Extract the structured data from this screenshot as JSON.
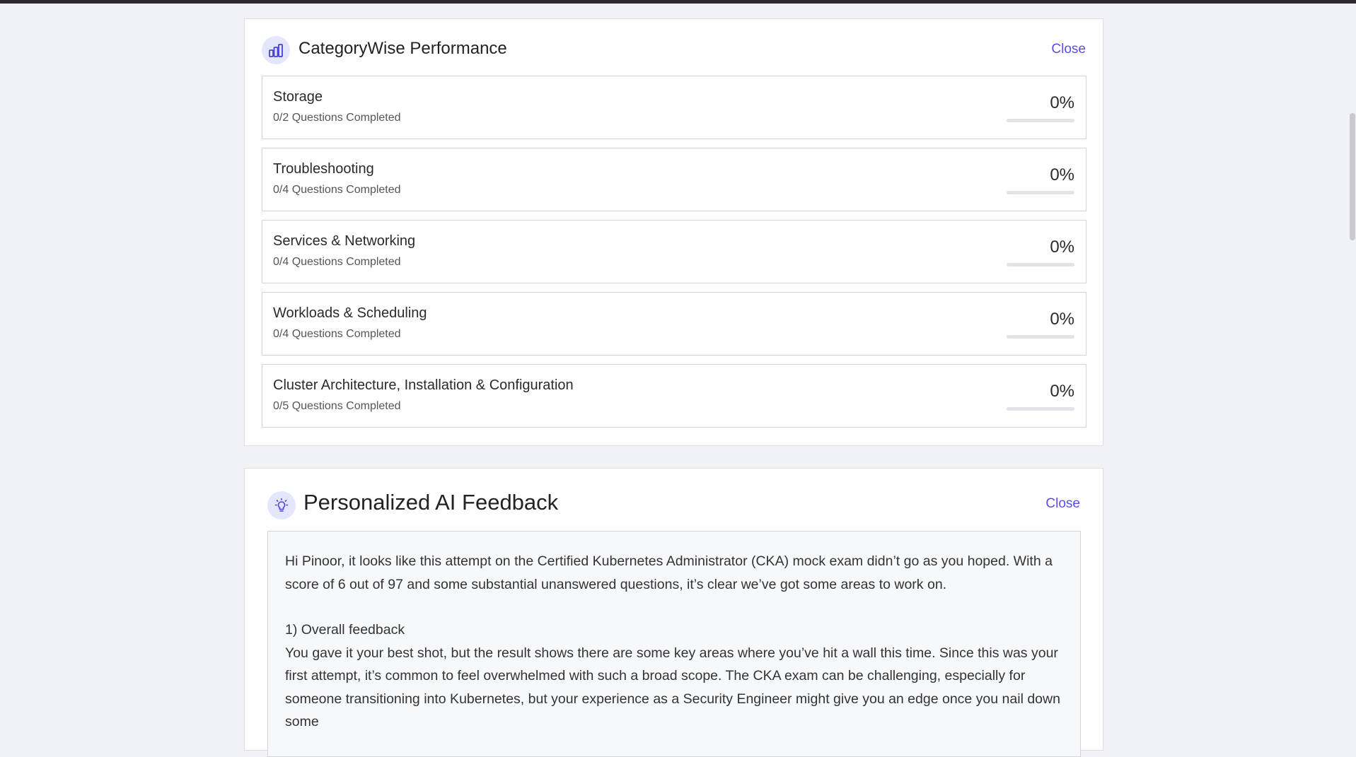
{
  "colors": {
    "accent": "#5a4ee6",
    "icon_bg": "#e4e6fb",
    "background": "#f1f2f5"
  },
  "performance": {
    "icon": "bar-chart-icon",
    "title": "CategoryWise Performance",
    "close_label": "Close",
    "categories": [
      {
        "name": "Storage",
        "completed": "0/2 Questions Completed",
        "percent_label": "0%",
        "progress": 0
      },
      {
        "name": "Troubleshooting",
        "completed": "0/4 Questions Completed",
        "percent_label": "0%",
        "progress": 0
      },
      {
        "name": "Services & Networking",
        "completed": "0/4 Questions Completed",
        "percent_label": "0%",
        "progress": 0
      },
      {
        "name": "Workloads & Scheduling",
        "completed": "0/4 Questions Completed",
        "percent_label": "0%",
        "progress": 0
      },
      {
        "name": "Cluster Architecture, Installation & Configuration",
        "completed": "0/5 Questions Completed",
        "percent_label": "0%",
        "progress": 0
      }
    ]
  },
  "feedback": {
    "icon": "lightbulb-icon",
    "title": "Personalized AI Feedback",
    "close_label": "Close",
    "paragraph_1": "Hi Pinoor, it looks like this attempt on the Certified Kubernetes Administrator (CKA) mock exam didn’t go as you hoped. With a score of 6 out of 97 and some substantial unanswered questions, it’s clear we’ve got some areas to work on.",
    "heading_1": "1) Overall feedback",
    "paragraph_2": "You gave it your best shot, but the result shows there are some key areas where you’ve hit a wall this time. Since this was your first attempt, it’s common to feel overwhelmed with such a broad scope. The CKA exam can be challenging, especially for someone transitioning into Kubernetes, but your experience as a Security Engineer might give you an edge once you nail down some"
  }
}
